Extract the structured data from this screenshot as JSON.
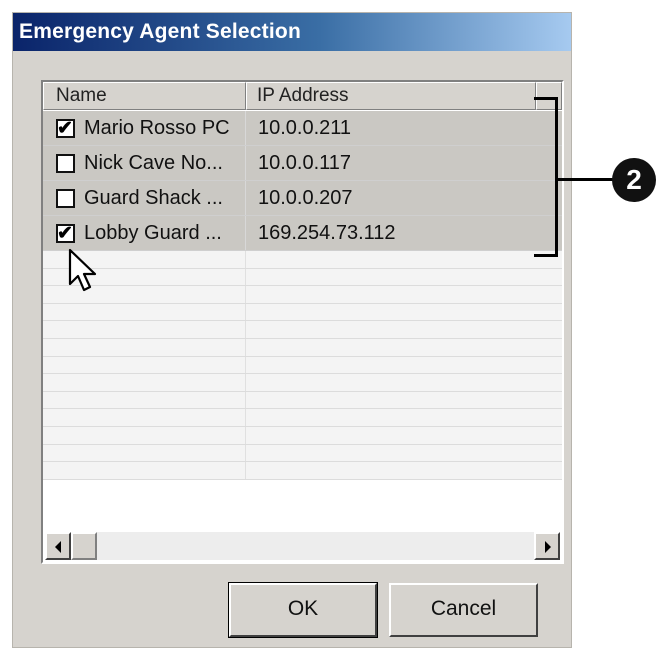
{
  "window": {
    "title": "Emergency Agent Selection"
  },
  "list": {
    "columns": [
      "Name",
      "IP Address"
    ],
    "rows": [
      {
        "name": "Mario Rosso PC",
        "ip": "10.0.0.211",
        "checked": true
      },
      {
        "name": "Nick Cave No...",
        "ip": "10.0.0.117",
        "checked": false
      },
      {
        "name": "Guard Shack ...",
        "ip": "10.0.0.207",
        "checked": false
      },
      {
        "name": "Lobby Guard ...",
        "ip": "169.254.73.112",
        "checked": true
      }
    ]
  },
  "buttons": {
    "ok": "OK",
    "cancel": "Cancel"
  },
  "callout": {
    "label": "2"
  },
  "icons": {
    "checkbox_checked": "check-mark-icon",
    "scroll_left": "arrow-left-icon",
    "scroll_right": "arrow-right-icon",
    "cursor": "mouse-pointer-icon"
  },
  "colors": {
    "titlebar_start": "#0a246a",
    "titlebar_end": "#a6caf0",
    "dialog_bg": "#d6d3ce",
    "selected_row_bg": "#cac8c3"
  }
}
